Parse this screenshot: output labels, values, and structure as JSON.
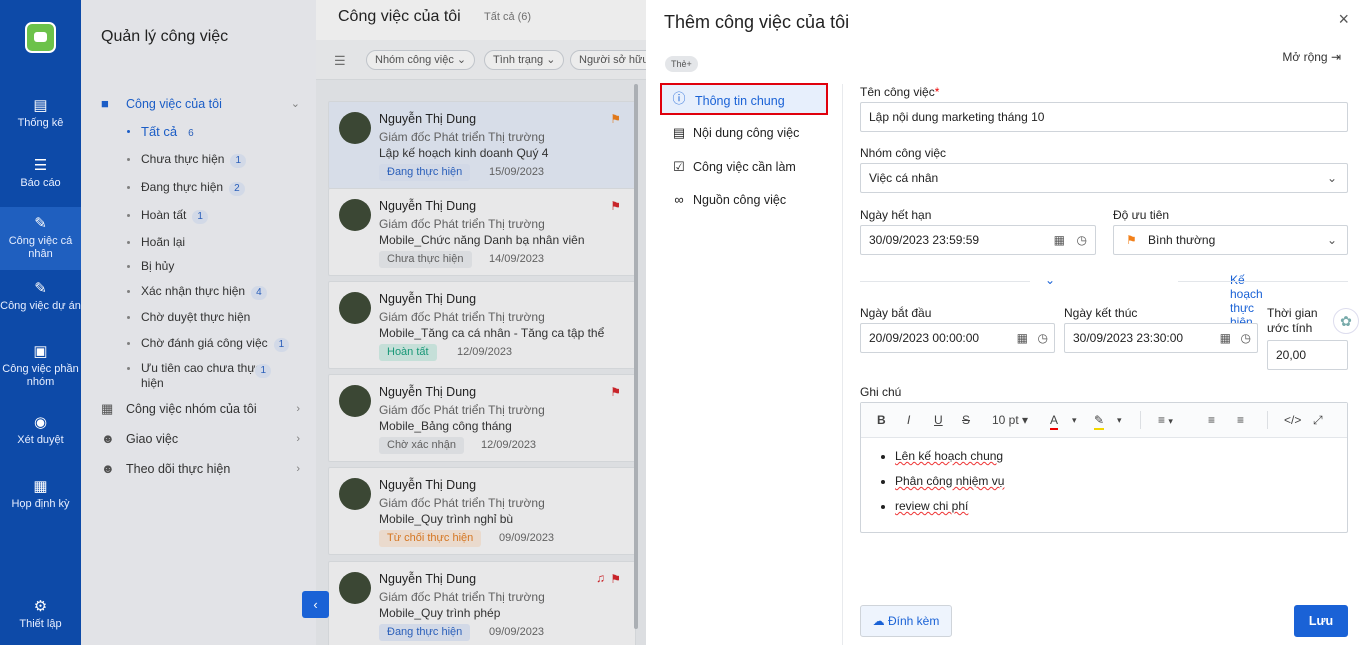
{
  "nav": {
    "items": [
      {
        "label": "Thống kê",
        "icon": "bar-chart-icon"
      },
      {
        "label": "Báo cáo",
        "icon": "report-icon"
      },
      {
        "label": "Công việc cá nhân",
        "icon": "personal-task-icon"
      },
      {
        "label": "Công việc dự án",
        "icon": "project-icon"
      },
      {
        "label": "Công việc phần nhóm",
        "icon": "group-task-icon"
      },
      {
        "label": "Xét duyệt",
        "icon": "approve-icon"
      },
      {
        "label": "Họp định kỳ",
        "icon": "calendar-icon"
      },
      {
        "label": "Thiết lập",
        "icon": "gear-icon"
      }
    ]
  },
  "panel": {
    "title": "Quản lý công việc",
    "my_tasks": "Công việc của tôi",
    "sub": [
      {
        "label": "Tất cả",
        "count": "6"
      },
      {
        "label": "Chưa thực hiện",
        "count": "1"
      },
      {
        "label": "Đang thực hiện",
        "count": "2"
      },
      {
        "label": "Hoàn tất",
        "count": "1"
      },
      {
        "label": "Hoãn lại",
        "count": ""
      },
      {
        "label": "Bị hủy",
        "count": ""
      },
      {
        "label": "Xác nhận thực hiện",
        "count": "4"
      },
      {
        "label": "Chờ duyệt thực hiện",
        "count": ""
      },
      {
        "label": "Chờ đánh giá công việc",
        "count": "1"
      },
      {
        "label": "Ưu tiên cao chưa thực hiện",
        "count": "1"
      }
    ],
    "group_tasks": "Công việc nhóm của tôi",
    "assign": "Giao việc",
    "follow": "Theo dõi thực hiện"
  },
  "list": {
    "title": "Công việc của tôi",
    "count": "Tất cả (6)",
    "filters": [
      "Nhóm công việc",
      "Tình trạng",
      "Người sở hữu"
    ],
    "cards": [
      {
        "name": "Nguyễn Thị Dung",
        "position": "Giám đốc Phát triển Thị trường",
        "task": "Lập kế hoạch kinh doanh Quý 4",
        "status": "Đang thực hiện",
        "date": "15/09/2023",
        "status_bg": "#e3ebfa",
        "status_fg": "#2a64c8"
      },
      {
        "name": "Nguyễn Thị Dung",
        "position": "Giám đốc Phát triển Thị trường",
        "task": "Mobile_Chức năng Danh bạ nhân viên",
        "status": "Chưa thực hiện",
        "date": "14/09/2023",
        "status_bg": "#eceef1",
        "status_fg": "#666666"
      },
      {
        "name": "Nguyễn Thị Dung",
        "position": "Giám đốc Phát triển Thị trường",
        "task": "Mobile_Tăng ca cá nhân - Tăng ca tập thể",
        "status": "Hoàn tất",
        "date": "12/09/2023",
        "status_bg": "#d5f1ea",
        "status_fg": "#17a37f"
      },
      {
        "name": "Nguyễn Thị Dung",
        "position": "Giám đốc Phát triển Thị trường",
        "task": "Mobile_Bảng công tháng",
        "status": "Chờ xác nhận",
        "date": "12/09/2023",
        "status_bg": "#eceef1",
        "status_fg": "#666666"
      },
      {
        "name": "Nguyễn Thị Dung",
        "position": "Giám đốc Phát triển Thị trường",
        "task": "Mobile_Quy trình nghỉ bù",
        "status": "Từ chối thực hiện",
        "date": "09/09/2023",
        "status_bg": "#fdecdd",
        "status_fg": "#e67e22"
      },
      {
        "name": "Nguyễn Thị Dung",
        "position": "Giám đốc Phát triển Thị trường",
        "task": "Mobile_Quy trình phép",
        "status": "Đang thực hiện",
        "date": "09/09/2023",
        "status_bg": "#e3ebfa",
        "status_fg": "#2a64c8"
      }
    ]
  },
  "dialog": {
    "title": "Thêm công việc của tôi",
    "tag": "Thẻ+",
    "expand": "Mở rộng",
    "tabs": [
      "Thông tin chung",
      "Nội dung công việc",
      "Công việc cần làm",
      "Nguồn công việc"
    ],
    "task_name_label": "Tên công việc",
    "task_name_value": "Lập nội dung marketing tháng 10",
    "group_label": "Nhóm công việc",
    "group_value": "Việc cá nhân",
    "deadline_label": "Ngày hết hạn",
    "deadline_value": "30/09/2023 23:59:59",
    "priority_label": "Độ ưu tiên",
    "priority_value": "Bình thường",
    "plan_label": "Kế hoạch thực hiện",
    "start_label": "Ngày bắt đầu",
    "start_value": "20/09/2023 00:00:00",
    "end_label": "Ngày kết thúc",
    "end_value": "30/09/2023 23:30:00",
    "estimate_label": "Thời gian ước tính thực hiện",
    "estimate_value": "20,00",
    "note_label": "Ghi chú",
    "font_size": "10 pt",
    "notes": [
      "Lên kế hoạch chung",
      "Phân công nhiệm vụ",
      "review chi phí"
    ],
    "attach_label": "Đính kèm",
    "save_label": "Lưu"
  },
  "colors": {
    "nav": "#0d4aa8",
    "accent": "#1a62d6",
    "flag_red": "#d8242a",
    "flag_orange": "#f2801a"
  }
}
